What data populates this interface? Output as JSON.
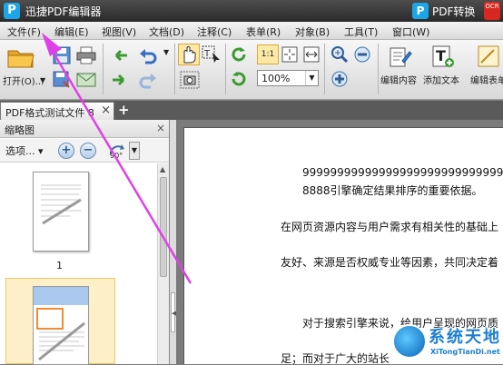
{
  "app": {
    "title": "迅捷PDF编辑器",
    "logo_letter": "P",
    "convert_label": "PDF转换",
    "ocr_badge": "OCR"
  },
  "menu": [
    "文件(F)",
    "编辑(E)",
    "视图(V)",
    "文档(D)",
    "注释(C)",
    "表单(R)",
    "对象(B)",
    "工具(T)",
    "窗口(W)"
  ],
  "toolbar": {
    "open_label": "打开(O)...",
    "zoom_value": "100%",
    "zoom_dropdown_glyph": "▼",
    "actual_size_label": "1:1",
    "edit_content_label": "编辑内容",
    "add_text_label": "添加文本",
    "edit_form_label": "编辑表单"
  },
  "tabs": {
    "doc_tab": "PDF格式测试文件 8",
    "close": "×",
    "new_tab": "+"
  },
  "thumbnails": {
    "title": "缩略图",
    "close": "×",
    "options": "选项...",
    "rotate": "90°",
    "page1_number": "1",
    "page_count": 2
  },
  "document": {
    "lines": [
      "99999999999999999999999999999999",
      "8888引擎确定结果排序的重要依据。",
      "在网页资源内容与用户需求有相关性的基础上",
      "友好、来源是否权威专业等因素，共同决定着",
      "对于搜索引擎来说，给用户呈现的网页质",
      "足；而对于广大的站长"
    ]
  },
  "watermark": {
    "cn": "系统天地",
    "en": "XiTongTianDi.net"
  },
  "colors": {
    "annotation_arrow": "#e040e8",
    "accent_blue": "#1aa6e8",
    "selection": "#fdf0c8"
  }
}
